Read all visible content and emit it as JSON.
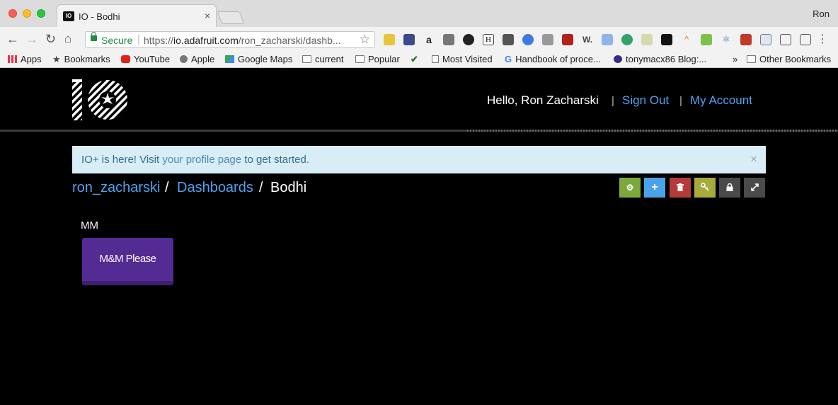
{
  "browser": {
    "tab_title": "IO - Bodhi",
    "tab_close": "×",
    "profile_name": "Ron",
    "secure_label": "Secure",
    "url_scheme": "https://",
    "url_host": "io.adafruit.com",
    "url_path": "/ron_zacharski/dashb...",
    "bookmarks": [
      {
        "label": "Apps",
        "icon": "apps-grid-icon"
      },
      {
        "label": "Bookmarks",
        "icon": "star-icon"
      },
      {
        "label": "YouTube",
        "icon": "youtube-icon"
      },
      {
        "label": "Apple",
        "icon": "apple-icon"
      },
      {
        "label": "Google Maps",
        "icon": "google-maps-icon"
      },
      {
        "label": "current",
        "icon": "folder-icon"
      },
      {
        "label": "Popular",
        "icon": "folder-icon"
      },
      {
        "label": "",
        "icon": "checkmark-icon"
      },
      {
        "label": "Most Visited",
        "icon": "page-icon"
      },
      {
        "label": "Handbook of proce...",
        "icon": "google-icon"
      },
      {
        "label": "tonymacx86 Blog:...",
        "icon": "tonymacx86-icon"
      }
    ],
    "overflow": "»",
    "other_bookmarks": "Other Bookmarks"
  },
  "header": {
    "greeting": "Hello, Ron Zacharski",
    "separator": "|",
    "sign_out": "Sign Out",
    "my_account": "My Account"
  },
  "alert": {
    "prefix": "IO+ is here! Visit ",
    "link": "your profile page",
    "suffix": " to get started.",
    "close": "×"
  },
  "breadcrumb": {
    "user": "ron_zacharski",
    "slash": "/",
    "dashboards": "Dashboards",
    "current": "Bodhi"
  },
  "actions": [
    {
      "name": "settings",
      "icon": "gear-icon",
      "color": "#7ca83c"
    },
    {
      "name": "add-block",
      "icon": "plus-icon",
      "color": "#4aa3e8"
    },
    {
      "name": "delete",
      "icon": "trash-icon",
      "color": "#b53a3a"
    },
    {
      "name": "key",
      "icon": "key-icon",
      "color": "#a7ab3c"
    },
    {
      "name": "lock",
      "icon": "lock-icon",
      "color": "#4a4a4a"
    },
    {
      "name": "fullscreen",
      "icon": "expand-icon",
      "color": "#4a4a4a"
    }
  ],
  "block": {
    "title": "MM",
    "button_label": "M&M Please",
    "button_color": "#542a93"
  }
}
